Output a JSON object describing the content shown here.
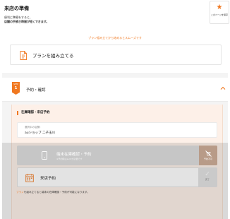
{
  "page": {
    "title": "来店の準備",
    "desc_line1": "便利に準備をすると、",
    "desc_line2": "店舗の手続き時間が短くできます。"
  },
  "save_button": {
    "label": "このページを保存"
  },
  "plan_hint": "プラン組み立てから始めるとスムーズです",
  "plan_card": {
    "label": "プランを組み立てる"
  },
  "step": {
    "badge_label": "STEP",
    "badge_number": "1",
    "title": "予約・確認"
  },
  "section": {
    "title": "在庫確認・来店予約",
    "store_label": "選択中の店舗：",
    "store_value": "auショップ 二子玉川"
  },
  "stock_button": {
    "label": "端末在庫確認・予約",
    "sub": "※予約時はauIDが必要です",
    "side_label": "予約不可"
  },
  "note": {
    "highlight": "プラン",
    "text": "を組み立てると端末の在庫確認・予約が可能になります。"
  },
  "visit_button": {
    "label": "来店予約",
    "done_label": "完了"
  },
  "colors": {
    "accent": "#f07820",
    "panel_bg": "#fdf0e8",
    "disabled": "#c6c6c6"
  }
}
